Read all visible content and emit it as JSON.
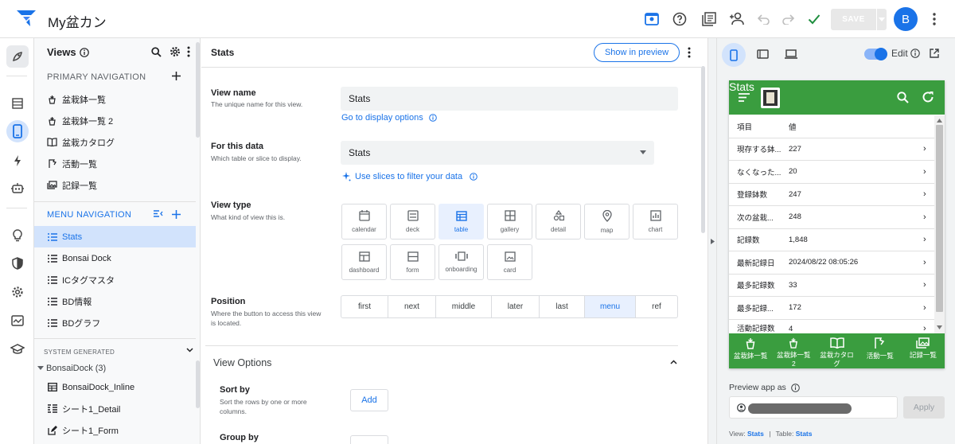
{
  "app": {
    "title": "My盆カン"
  },
  "topbar": {
    "save_label": "SAVE",
    "avatar_initial": "B"
  },
  "views_panel": {
    "title": "Views",
    "primary_header": "PRIMARY NAVIGATION",
    "primary_items": [
      {
        "label": "盆栽鉢一覧",
        "icon": "pot-icon"
      },
      {
        "label": "盆栽鉢一覧 2",
        "icon": "pot-icon"
      },
      {
        "label": "盆栽カタログ",
        "icon": "book-icon"
      },
      {
        "label": "活動一覧",
        "icon": "flag-icon"
      },
      {
        "label": "記録一覧",
        "icon": "photos-icon"
      }
    ],
    "menu_header": "MENU NAVIGATION",
    "menu_items": [
      {
        "label": "Stats",
        "selected": true
      },
      {
        "label": "Bonsai Dock",
        "selected": false
      },
      {
        "label": "ICタグマスタ",
        "selected": false
      },
      {
        "label": "BD情報",
        "selected": false
      },
      {
        "label": "BDグラフ",
        "selected": false
      }
    ],
    "system_header": "SYSTEM GENERATED",
    "group_label": "BonsaiDock (3)",
    "system_items": [
      {
        "label": "BonsaiDock_Inline",
        "icon": "table-icon"
      },
      {
        "label": "シート1_Detail",
        "icon": "detail-icon"
      },
      {
        "label": "シート1_Form",
        "icon": "form-edit-icon"
      }
    ]
  },
  "editor": {
    "title": "Stats",
    "show_preview": "Show in preview",
    "view_name": {
      "label": "View name",
      "sub": "The unique name for this view.",
      "value": "Stats",
      "link": "Go to display options"
    },
    "data": {
      "label": "For this data",
      "sub": "Which table or slice to display.",
      "value": "Stats",
      "link": "Use slices to filter your data"
    },
    "view_type": {
      "label": "View type",
      "sub": "What kind of view this is.",
      "options": [
        "calendar",
        "deck",
        "table",
        "gallery",
        "detail",
        "map",
        "chart",
        "dashboard",
        "form",
        "onboarding",
        "card"
      ],
      "selected": "table"
    },
    "position": {
      "label": "Position",
      "sub": "Where the button to access this view is located.",
      "options": [
        "first",
        "next",
        "middle",
        "later",
        "last",
        "menu",
        "ref"
      ],
      "selected": "menu"
    },
    "view_options": {
      "label": "View Options"
    },
    "sort": {
      "label": "Sort by",
      "sub": "Sort the rows by one or more columns.",
      "button": "Add"
    },
    "group": {
      "label": "Group by"
    }
  },
  "preview": {
    "edit_label": "Edit",
    "phone": {
      "title": "Stats",
      "columns": [
        "項目",
        "値"
      ],
      "rows": [
        {
          "k": "現存する鉢...",
          "v": "227"
        },
        {
          "k": "なくなった...",
          "v": "20"
        },
        {
          "k": "登録鉢数",
          "v": "247"
        },
        {
          "k": "次の盆栽...",
          "v": "248"
        },
        {
          "k": "記録数",
          "v": "1,848"
        },
        {
          "k": "最新記録日",
          "v": "2024/08/22 08:05:26"
        },
        {
          "k": "最多記録数",
          "v": "33"
        },
        {
          "k": "最多記録...",
          "v": "172"
        },
        {
          "k": "活動記録数",
          "v": "4"
        }
      ],
      "footer": [
        "盆栽鉢一覧",
        "盆栽鉢一覧\n2",
        "盆栽カタロ\nグ",
        "活動一覧",
        "記録一覧"
      ]
    },
    "preview_as_label": "Preview app as",
    "apply_label": "Apply",
    "footer": {
      "view_label": "View:",
      "view_value": "Stats",
      "sep": "|",
      "table_label": "Table:",
      "table_value": "Stats"
    }
  },
  "colors": {
    "accent": "#1a73e8",
    "app_green": "#3a9d3f",
    "selected_bg": "#d2e3fc"
  }
}
